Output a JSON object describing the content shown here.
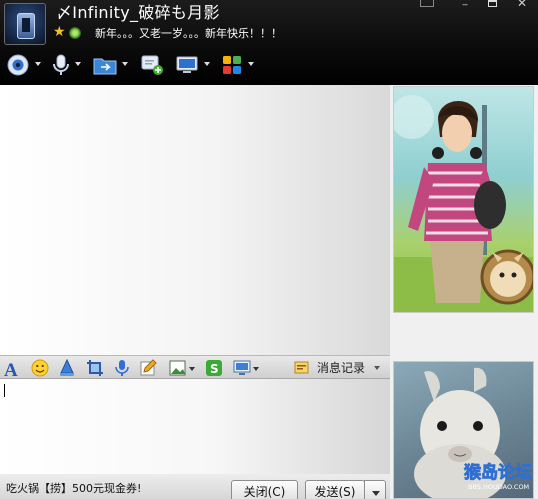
{
  "title_bar": {
    "nickname": "〆Infinity_破碎も月影",
    "signature": "新年。。。又老一岁。。。新年快乐！！！"
  },
  "toolbar": {
    "icons": [
      "video-icon",
      "mic-icon",
      "file-transfer-icon",
      "add-chat-icon",
      "remote-assist-icon",
      "app-grid-icon"
    ]
  },
  "input_toolbar": {
    "icons": [
      "font-icon",
      "smiley-icon",
      "shake-icon",
      "screenshot-icon",
      "voice-message-icon",
      "edit-icon",
      "image-icon",
      "music-icon",
      "screen-share-icon"
    ],
    "message_history_label": "消息记录"
  },
  "footer": {
    "ad_text": "吃火锅【捞】500元现金券!",
    "close_label": "关闭(C)",
    "send_label": "发送(S)"
  },
  "watermark": {
    "text": "猴岛论坛",
    "url_text": "BBS.HOUDAO.COM"
  },
  "colors": {
    "title_bg": "#0a0a0a",
    "chat_bg": "#ffffff",
    "accent_blue": "#2f6fd1"
  }
}
